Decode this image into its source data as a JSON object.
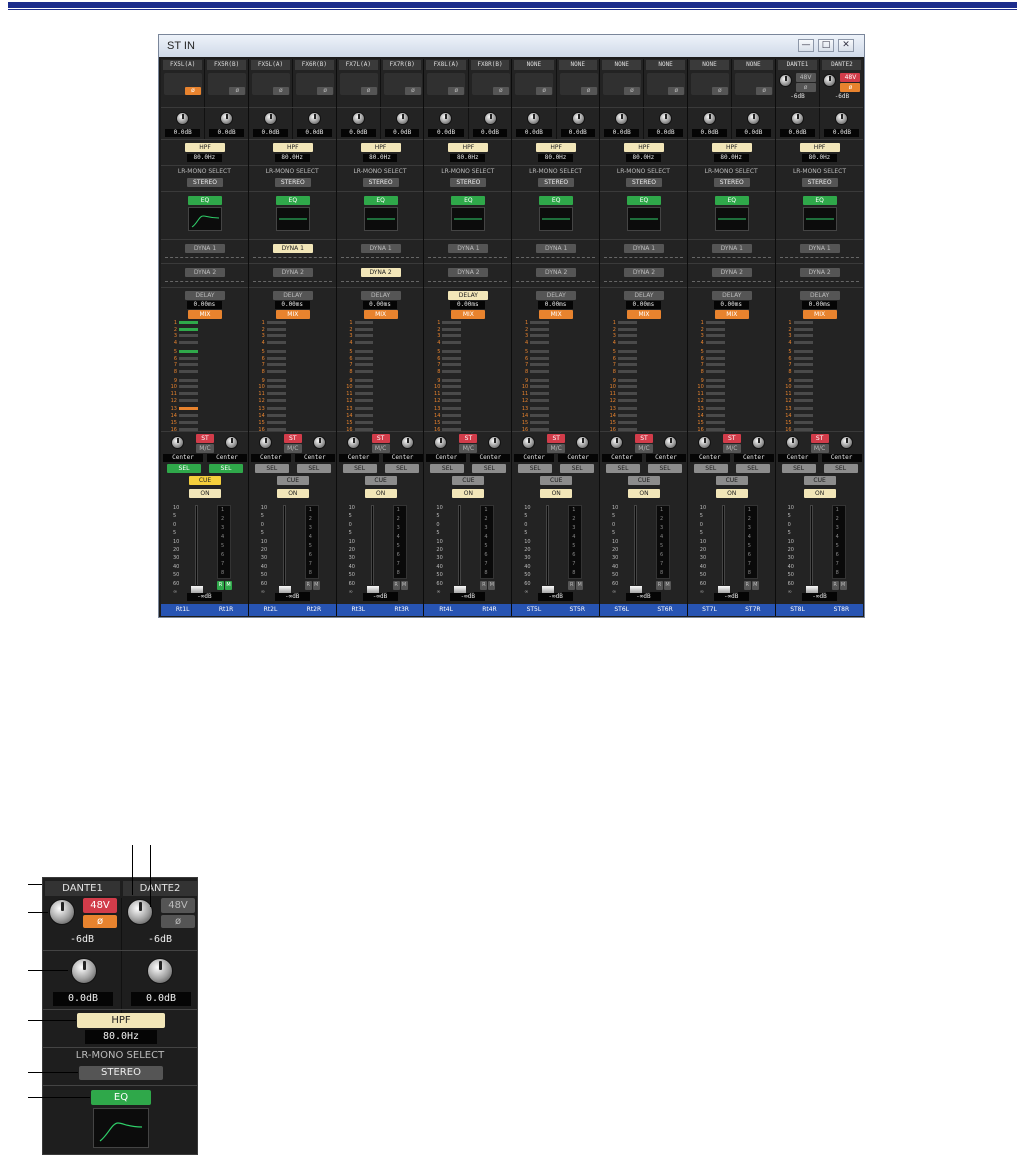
{
  "window": {
    "title": "ST IN",
    "minimize": "—",
    "maximize": "□",
    "close": "✕"
  },
  "strips": [
    {
      "ch": [
        "FX5L(A)",
        "FX5R(B)"
      ],
      "gain": [
        "0.0dB",
        "0.0dB"
      ],
      "hpf": "HPF",
      "hpf_freq": "80.0Hz",
      "lrmono_label": "LR-MONO SELECT",
      "lrmono": "STEREO",
      "eq": "EQ",
      "dyna1": "DYNA 1",
      "dyna2": "DYNA 2",
      "delay": "DELAY",
      "delay_val": "0.00ms",
      "mix": "MIX",
      "st": "ST",
      "mono": "M/C",
      "pan": [
        "Center",
        "Center"
      ],
      "sel": [
        "SEL",
        "SEL"
      ],
      "cue": "CUE",
      "on": "ON",
      "num": "1",
      "level": "-∞dB",
      "out": [
        "Rt1L",
        "Rt1R"
      ]
    },
    {
      "ch": [
        "FX5L(A)",
        "FX6R(B)"
      ],
      "gain": [
        "0.0dB",
        "0.0dB"
      ],
      "hpf": "HPF",
      "hpf_freq": "80.0Hz",
      "lrmono_label": "LR-MONO SELECT",
      "lrmono": "STEREO",
      "eq": "EQ",
      "dyna1": "DYNA 1",
      "dyna2": "DYNA 2",
      "delay": "DELAY",
      "delay_val": "0.00ms",
      "mix": "MIX",
      "st": "ST",
      "mono": "M/C",
      "pan": [
        "Center",
        "Center"
      ],
      "sel": [
        "SEL",
        "SEL"
      ],
      "cue": "CUE",
      "on": "ON",
      "num": "2",
      "level": "-∞dB",
      "out": [
        "Rt2L",
        "Rt2R"
      ]
    },
    {
      "ch": [
        "FX7L(A)",
        "FX7R(B)"
      ],
      "gain": [
        "0.0dB",
        "0.0dB"
      ],
      "hpf": "HPF",
      "hpf_freq": "80.0Hz",
      "lrmono_label": "LR-MONO SELECT",
      "lrmono": "STEREO",
      "eq": "EQ",
      "dyna1": "DYNA 1",
      "dyna2": "DYNA 2",
      "delay": "DELAY",
      "delay_val": "0.00ms",
      "mix": "MIX",
      "st": "ST",
      "mono": "M/C",
      "pan": [
        "Center",
        "Center"
      ],
      "sel": [
        "SEL",
        "SEL"
      ],
      "cue": "CUE",
      "on": "ON",
      "num": "3",
      "level": "-∞dB",
      "out": [
        "Rt3L",
        "Rt3R"
      ]
    },
    {
      "ch": [
        "FX8L(A)",
        "FX8R(B)"
      ],
      "gain": [
        "0.0dB",
        "0.0dB"
      ],
      "hpf": "HPF",
      "hpf_freq": "80.0Hz",
      "lrmono_label": "LR-MONO SELECT",
      "lrmono": "STEREO",
      "eq": "EQ",
      "dyna1": "DYNA 1",
      "dyna2": "DYNA 2",
      "delay": "DELAY",
      "delay_val": "0.00ms",
      "mix": "MIX",
      "st": "ST",
      "mono": "M/C",
      "pan": [
        "Center",
        "Center"
      ],
      "sel": [
        "SEL",
        "SEL"
      ],
      "cue": "CUE",
      "on": "ON",
      "num": "4",
      "level": "-∞dB",
      "out": [
        "Rt4L",
        "Rt4R"
      ]
    },
    {
      "ch": [
        "NONE",
        "NONE"
      ],
      "gain": [
        "0.0dB",
        "0.0dB"
      ],
      "hpf": "HPF",
      "hpf_freq": "80.0Hz",
      "lrmono_label": "LR-MONO SELECT",
      "lrmono": "STEREO",
      "eq": "EQ",
      "dyna1": "DYNA 1",
      "dyna2": "DYNA 2",
      "delay": "DELAY",
      "delay_val": "0.00ms",
      "mix": "MIX",
      "st": "ST",
      "mono": "M/C",
      "pan": [
        "Center",
        "Center"
      ],
      "sel": [
        "SEL",
        "SEL"
      ],
      "cue": "CUE",
      "on": "ON",
      "num": "5",
      "level": "-∞dB",
      "out": [
        "ST5L",
        "ST5R"
      ]
    },
    {
      "ch": [
        "NONE",
        "NONE"
      ],
      "gain": [
        "0.0dB",
        "0.0dB"
      ],
      "hpf": "HPF",
      "hpf_freq": "80.0Hz",
      "lrmono_label": "LR-MONO SELECT",
      "lrmono": "STEREO",
      "eq": "EQ",
      "dyna1": "DYNA 1",
      "dyna2": "DYNA 2",
      "delay": "DELAY",
      "delay_val": "0.00ms",
      "mix": "MIX",
      "st": "ST",
      "mono": "M/C",
      "pan": [
        "Center",
        "Center"
      ],
      "sel": [
        "SEL",
        "SEL"
      ],
      "cue": "CUE",
      "on": "ON",
      "num": "6",
      "level": "-∞dB",
      "out": [
        "ST6L",
        "ST6R"
      ]
    },
    {
      "ch": [
        "NONE",
        "NONE"
      ],
      "gain": [
        "0.0dB",
        "0.0dB"
      ],
      "hpf": "HPF",
      "hpf_freq": "80.0Hz",
      "lrmono_label": "LR-MONO SELECT",
      "lrmono": "STEREO",
      "eq": "EQ",
      "dyna1": "DYNA 1",
      "dyna2": "DYNA 2",
      "delay": "DELAY",
      "delay_val": "0.00ms",
      "mix": "MIX",
      "st": "ST",
      "mono": "M/C",
      "pan": [
        "Center",
        "Center"
      ],
      "sel": [
        "SEL",
        "SEL"
      ],
      "cue": "CUE",
      "on": "ON",
      "num": "7",
      "level": "-∞dB",
      "out": [
        "ST7L",
        "ST7R"
      ]
    },
    {
      "ch": [
        "DANTE1",
        "DANTE2"
      ],
      "gain": [
        "0.0dB",
        "0.0dB"
      ],
      "hpf": "HPF",
      "hpf_freq": "80.0Hz",
      "lrmono_label": "LR-MONO SELECT",
      "lrmono": "STEREO",
      "eq": "EQ",
      "dyna1": "DYNA 1",
      "dyna2": "DYNA 2",
      "delay": "DELAY",
      "delay_val": "0.00ms",
      "mix": "MIX",
      "st": "ST",
      "mono": "M/C",
      "pan": [
        "Center",
        "Center"
      ],
      "sel": [
        "SEL",
        "SEL"
      ],
      "cue": "CUE",
      "on": "ON",
      "num": "8",
      "level": "-∞dB",
      "out": [
        "ST8L",
        "ST8R"
      ],
      "ha": [
        "-6dB",
        "-6dB"
      ],
      "ph48": "48V"
    }
  ],
  "meter": {
    "scale": [
      "10",
      "5",
      "0",
      "5",
      "10",
      "20",
      "30",
      "40",
      "50",
      "60",
      "∞"
    ],
    "groups": [
      "1",
      "2",
      "3",
      "4",
      "5",
      "6",
      "7",
      "8"
    ],
    "rm": [
      "R",
      "M"
    ]
  },
  "mix_numbers": [
    "1",
    "2",
    "3",
    "4",
    "5",
    "6",
    "7",
    "8",
    "9",
    "10",
    "11",
    "12",
    "13",
    "14",
    "15",
    "16"
  ],
  "zoom": {
    "ch": [
      "DANTE1",
      "DANTE2"
    ],
    "ph48": "48V",
    "phase": "ø",
    "ha": [
      "-6dB",
      "-6dB"
    ],
    "gain": [
      "0.0dB",
      "0.0dB"
    ],
    "hpf": "HPF",
    "hpf_freq": "80.0Hz",
    "lrmono_label": "LR-MONO SELECT",
    "lrmono": "STEREO",
    "eq": "EQ"
  },
  "colors": {
    "accent_orange": "#e8832e",
    "accent_green": "#2fa84a",
    "accent_red": "#d23c4a",
    "out_blue": "#2754b3"
  }
}
